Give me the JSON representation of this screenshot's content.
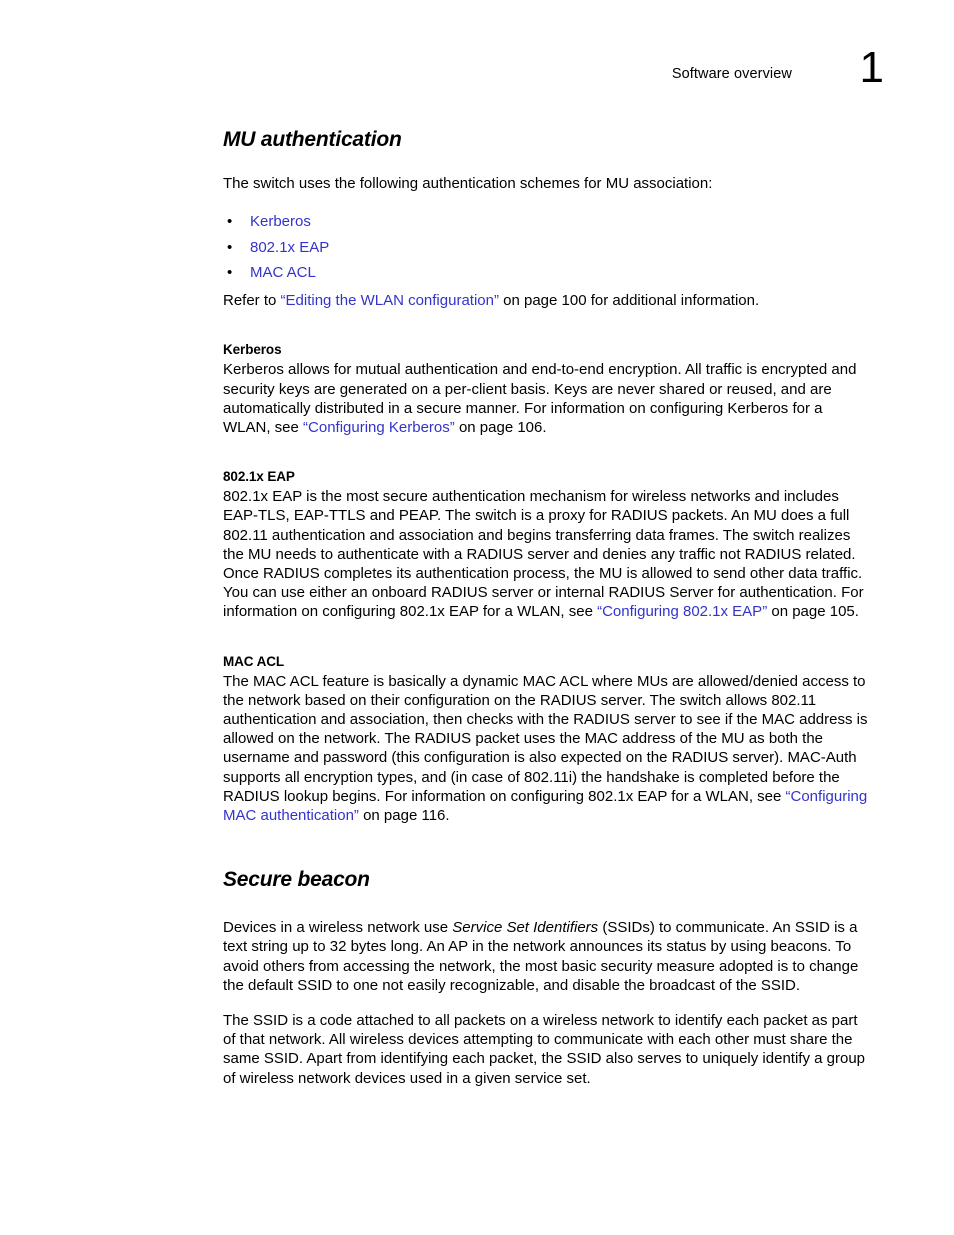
{
  "header": {
    "title": "Software overview",
    "chapter_number": "1"
  },
  "colors": {
    "link": "#3333cc",
    "text": "#000000",
    "background": "#ffffff"
  },
  "sections": {
    "mu_authentication": {
      "heading": "MU authentication",
      "intro": "The switch uses the following authentication schemes for MU association:",
      "bullet_marker": "•",
      "links": [
        "Kerberos",
        "802.1x EAP",
        "MAC ACL"
      ],
      "refer_line": {
        "prefix": "Refer to ",
        "link": "“Editing the WLAN configuration”",
        "suffix": " on page 100 for additional information."
      },
      "subsections": [
        {
          "heading": "Kerberos",
          "body_prefix": "Kerberos allows for mutual authentication and end-to-end encryption. All traffic is encrypted and security keys are generated on a per-client basis. Keys are never shared or reused, and are automatically distributed in a secure manner. For information on configuring Kerberos for a WLAN, see ",
          "body_link": "“Configuring Kerberos”",
          "body_suffix": " on page 106."
        },
        {
          "heading": "802.1x EAP",
          "body_prefix": "802.1x EAP is the most secure authentication mechanism for wireless networks and includes EAP-TLS, EAP-TTLS and PEAP. The switch is a proxy for RADIUS packets. An MU does a full 802.11 authentication and association and begins transferring data frames. The switch realizes the MU needs to authenticate with a RADIUS server and denies any traffic not RADIUS related. Once RADIUS completes its authentication process, the MU is allowed to send other data traffic. You can use either an onboard RADIUS server or internal RADIUS Server for authentication. For information on configuring 802.1x EAP for a WLAN, see ",
          "body_link": "“Configuring 802.1x EAP”",
          "body_suffix": " on page 105."
        },
        {
          "heading": "MAC ACL",
          "body_prefix": "The MAC ACL feature is basically a dynamic MAC ACL where MUs are allowed/denied access to the network based on their configuration on the RADIUS server. The switch allows 802.11 authentication and association, then checks with the RADIUS server to see if the MAC address is allowed on the network. The RADIUS packet uses the MAC address of the MU as both the username and password (this configuration is also expected on the RADIUS server). MAC-Auth supports all encryption types, and (in case of 802.11i) the handshake is completed before the RADIUS lookup begins. For information on configuring 802.1x EAP for a WLAN, see ",
          "body_link": "“Configuring MAC authentication”",
          "body_suffix": " on page 116."
        }
      ]
    },
    "secure_beacon": {
      "heading": "Secure beacon",
      "paragraph1_part1": "Devices in a wireless network use ",
      "paragraph1_italic": "Service Set Identifiers",
      "paragraph1_part2": " (SSIDs) to communicate. An SSID is a text string up to 32 bytes long. An AP in the network announces its status by using beacons. To avoid others from accessing the network, the most basic security measure adopted is to change the default SSID to one not easily recognizable, and disable the broadcast of the SSID.",
      "paragraph2": "The SSID is a code attached to all packets on a wireless network to identify each packet as part of that network. All wireless devices attempting to communicate with each other must share the same SSID. Apart from identifying each packet, the SSID also serves to uniquely identify a group of wireless network devices used in a given service set."
    }
  }
}
